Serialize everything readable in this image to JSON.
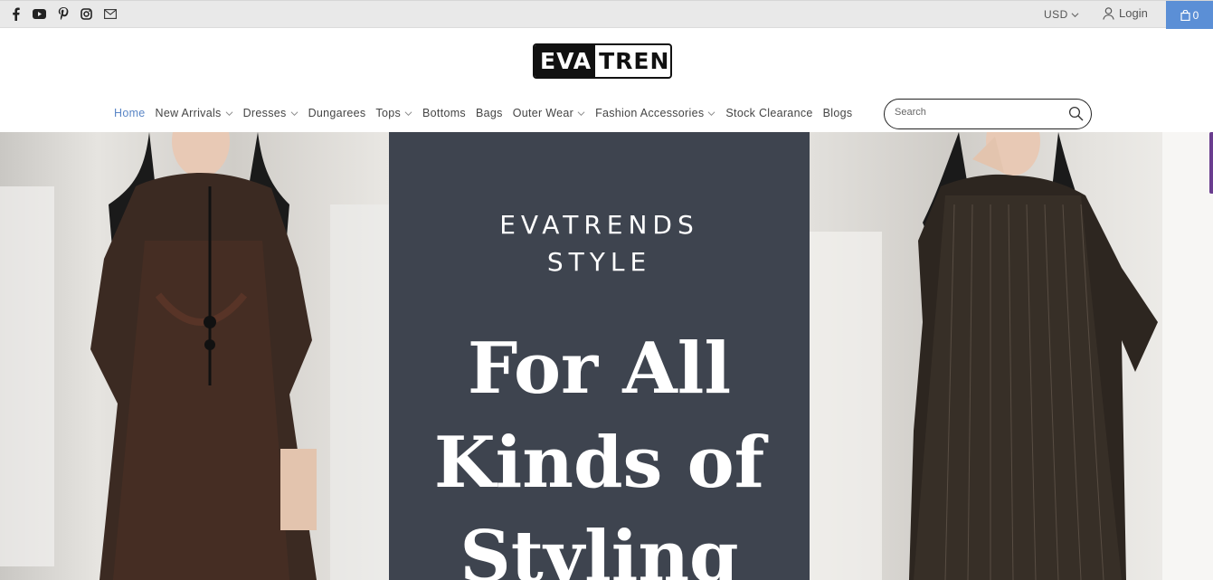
{
  "topbar": {
    "social_icons": [
      "facebook-icon",
      "youtube-icon",
      "pinterest-icon",
      "instagram-icon",
      "mail-icon"
    ],
    "currency": "USD",
    "login": "Login",
    "cart_count": "0",
    "cart_color": "#5b8fd6"
  },
  "logo": {
    "part1": "EVA",
    "part2": "TRENDS"
  },
  "nav": {
    "active_color": "#5a86c6",
    "items": [
      {
        "label": "Home",
        "dropdown": false
      },
      {
        "label": "New Arrivals",
        "dropdown": true
      },
      {
        "label": "Dresses",
        "dropdown": true
      },
      {
        "label": "Dungarees",
        "dropdown": false
      },
      {
        "label": "Tops",
        "dropdown": true
      },
      {
        "label": "Bottoms",
        "dropdown": false
      },
      {
        "label": "Bags",
        "dropdown": false
      },
      {
        "label": "Outer Wear",
        "dropdown": true
      },
      {
        "label": "Fashion Accessories",
        "dropdown": true
      },
      {
        "label": "Stock Clearance",
        "dropdown": false
      },
      {
        "label": "Blogs",
        "dropdown": false
      }
    ]
  },
  "search": {
    "placeholder": "Search"
  },
  "hero": {
    "brand_line1": "EVATRENDS",
    "brand_line2": "STYLE",
    "headline_line1": "For All",
    "headline_line2": "Kinds of",
    "headline_line3": "Styling",
    "panel_color": "#3e444f"
  }
}
